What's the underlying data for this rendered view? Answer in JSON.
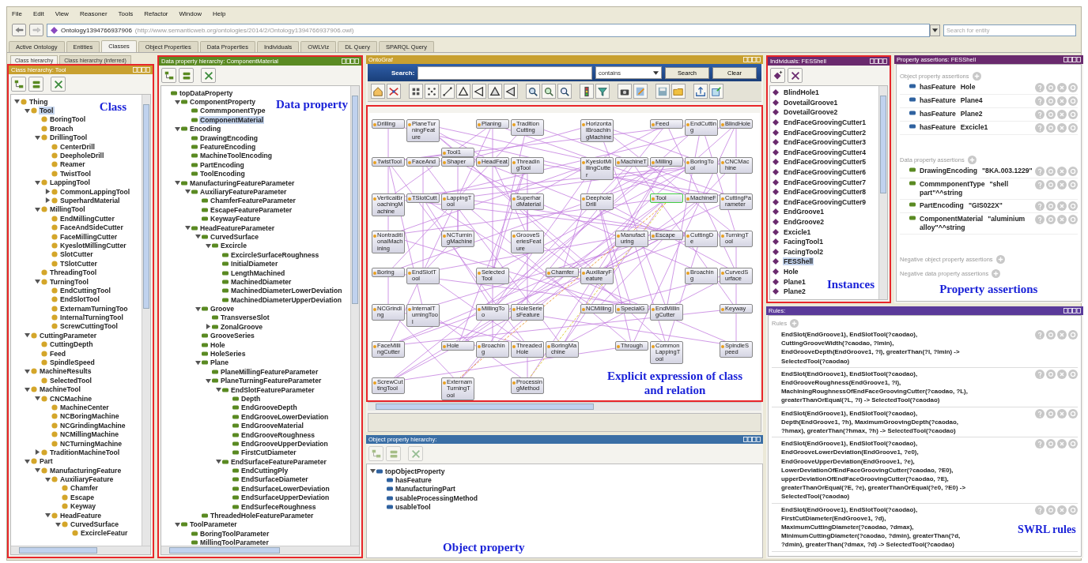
{
  "menu": [
    "File",
    "Edit",
    "View",
    "Reasoner",
    "Tools",
    "Refactor",
    "Window",
    "Help"
  ],
  "address": {
    "ontology": "Ontology1394766937906",
    "iri": "(http://www.semanticweb.org/ontologies/2014/2/Ontology1394766937906.owl)"
  },
  "entity_search": {
    "placeholder": "Search for entity"
  },
  "tabs": [
    {
      "label": "Active Ontology",
      "selected": false
    },
    {
      "label": "Entities",
      "selected": false
    },
    {
      "label": "Classes",
      "selected": true
    },
    {
      "label": "Object Properties",
      "selected": false
    },
    {
      "label": "Data Properties",
      "selected": false
    },
    {
      "label": "Individuals",
      "selected": false
    },
    {
      "label": "OWLViz",
      "selected": false
    },
    {
      "label": "DL Query",
      "selected": false
    },
    {
      "label": "SPARQL Query",
      "selected": false
    }
  ],
  "class_panel": {
    "subtabs": [
      {
        "label": "Class hierarchy",
        "selected": true
      },
      {
        "label": "Class hierarchy (inferred)",
        "selected": false
      }
    ],
    "title": "Class hierarchy: Tool",
    "annotation": "Class",
    "tree": [
      {
        "label": "Thing",
        "selected": false,
        "expanded": true,
        "children": [
          {
            "label": "Tool",
            "selected": true,
            "expanded": true,
            "children": [
              {
                "label": "BoringTool",
                "selected": false
              },
              {
                "label": "Broach",
                "selected": false
              },
              {
                "label": "DrillingTool",
                "selected": false,
                "expanded": true,
                "children": [
                  {
                    "label": "CenterDrill",
                    "selected": false
                  },
                  {
                    "label": "DeepholeDrill",
                    "selected": false
                  },
                  {
                    "label": "Reamer",
                    "selected": false
                  },
                  {
                    "label": "TwistTool",
                    "selected": false
                  }
                ]
              },
              {
                "label": "LappingTool",
                "selected": false,
                "expanded": true,
                "children": [
                  {
                    "label": "CommonLappingTool",
                    "selected": false,
                    "expanded": false
                  },
                  {
                    "label": "SuperhardMaterial",
                    "selected": false,
                    "expanded": false
                  }
                ]
              },
              {
                "label": "MillingTool",
                "selected": false,
                "expanded": true,
                "children": [
                  {
                    "label": "EndMillingCutter",
                    "selected": false
                  },
                  {
                    "label": "FaceAndSideCutter",
                    "selected": false
                  },
                  {
                    "label": "FaceMillingCutter",
                    "selected": false
                  },
                  {
                    "label": "KyeslotMillingCutter",
                    "selected": false
                  },
                  {
                    "label": "SlotCutter",
                    "selected": false
                  },
                  {
                    "label": "TSlotCutter",
                    "selected": false
                  }
                ]
              },
              {
                "label": "ThreadingTool",
                "selected": false
              },
              {
                "label": "TurningTool",
                "selected": false,
                "expanded": true,
                "children": [
                  {
                    "label": "EndCuttingTool",
                    "selected": false
                  },
                  {
                    "label": "EndSlotTool",
                    "selected": false
                  },
                  {
                    "label": "ExternamTurningToo",
                    "selected": false
                  },
                  {
                    "label": "InternalTurningTool",
                    "selected": false
                  },
                  {
                    "label": "ScrewCuttingTool",
                    "selected": false
                  }
                ]
              }
            ]
          },
          {
            "label": "CuttingParameter",
            "selected": false,
            "expanded": true,
            "children": [
              {
                "label": "CuttingDepth",
                "selected": false
              },
              {
                "label": "Feed",
                "selected": false
              },
              {
                "label": "SpindleSpeed",
                "selected": false
              }
            ]
          },
          {
            "label": "MachineResults",
            "selected": false,
            "expanded": true,
            "children": [
              {
                "label": "SelectedTool",
                "selected": false
              }
            ]
          },
          {
            "label": "MachineTool",
            "selected": false,
            "expanded": true,
            "children": [
              {
                "label": "CNCMachine",
                "selected": false,
                "expanded": true,
                "children": [
                  {
                    "label": "MachineCenter",
                    "selected": false
                  },
                  {
                    "label": "NCBoringMachine",
                    "selected": false
                  },
                  {
                    "label": "NCGrindingMachine",
                    "selected": false
                  },
                  {
                    "label": "NCMillingMachine",
                    "selected": false
                  },
                  {
                    "label": "NCTurningMachine",
                    "selected": false
                  }
                ]
              },
              {
                "label": "TraditionMachineTool",
                "selected": false,
                "expanded": false
              }
            ]
          },
          {
            "label": "Part",
            "selected": false,
            "expanded": true,
            "children": [
              {
                "label": "ManufacturingFeature",
                "selected": false,
                "expanded": true,
                "children": [
                  {
                    "label": "AuxiliaryFeature",
                    "selected": false,
                    "expanded": true,
                    "children": [
                      {
                        "label": "Chamfer",
                        "selected": false
                      },
                      {
                        "label": "Escape",
                        "selected": false
                      },
                      {
                        "label": "Keyway",
                        "selected": false
                      }
                    ]
                  },
                  {
                    "label": "HeadFeature",
                    "selected": false,
                    "expanded": true,
                    "children": [
                      {
                        "label": "CurvedSurface",
                        "selected": false,
                        "expanded": true,
                        "children": [
                          {
                            "label": "ExcircleFeatur",
                            "selected": false
                          }
                        ]
                      }
                    ]
                  }
                ]
              }
            ]
          }
        ]
      }
    ]
  },
  "data_property_panel": {
    "title": "Data property hierarchy: ComponentMaterial",
    "annotation": "Data property",
    "tree": [
      {
        "label": "topDataProperty",
        "selected": false,
        "children": [
          {
            "label": "ComponentProperty",
            "selected": false,
            "expanded": true,
            "children": [
              {
                "label": "CommmponentType",
                "selected": false
              },
              {
                "label": "ComponentMaterial",
                "selected": true
              }
            ]
          },
          {
            "label": "Encoding",
            "selected": false,
            "expanded": true,
            "children": [
              {
                "label": "DrawingEncoding",
                "selected": false
              },
              {
                "label": "FeatureEncoding",
                "selected": false
              },
              {
                "label": "MachineToolEncoding",
                "selected": false
              },
              {
                "label": "PartEncoding",
                "selected": false
              },
              {
                "label": "ToolEncoding",
                "selected": false
              }
            ]
          },
          {
            "label": "ManufacturingFeatureParameter",
            "selected": false,
            "expanded": true,
            "children": [
              {
                "label": "AuxiliaryFeatureParameter",
                "selected": false,
                "expanded": true,
                "children": [
                  {
                    "label": "ChamferFeatureParameter",
                    "selected": false
                  },
                  {
                    "label": "EscapeFeatureParameter",
                    "selected": false
                  },
                  {
                    "label": "KeywayFeature",
                    "selected": false
                  }
                ]
              },
              {
                "label": "HeadFeatureParameter",
                "selected": false,
                "expanded": true,
                "children": [
                  {
                    "label": "CurvedSurface",
                    "selected": false,
                    "expanded": true,
                    "children": [
                      {
                        "label": "Excircle",
                        "selected": false,
                        "expanded": true,
                        "children": [
                          {
                            "label": "ExcircleSurfaceRoughness",
                            "selected": false
                          },
                          {
                            "label": "InitialDiameter",
                            "selected": false
                          },
                          {
                            "label": "LengthMachined",
                            "selected": false
                          },
                          {
                            "label": "MachinedDiameter",
                            "selected": false
                          },
                          {
                            "label": "MachinedDiameterLowerDeviation",
                            "selected": false
                          },
                          {
                            "label": "MachinedDiameterUpperDeviation",
                            "selected": false
                          }
                        ]
                      }
                    ]
                  },
                  {
                    "label": "Groove",
                    "selected": false,
                    "expanded": true,
                    "children": [
                      {
                        "label": "TransverseSlot",
                        "selected": false
                      },
                      {
                        "label": "ZonalGroove",
                        "selected": false,
                        "expanded": false
                      }
                    ]
                  },
                  {
                    "label": "GrooveSeries",
                    "selected": false
                  },
                  {
                    "label": "Hole",
                    "selected": false
                  },
                  {
                    "label": "HoleSeries",
                    "selected": false
                  },
                  {
                    "label": "Plane",
                    "selected": false,
                    "expanded": true,
                    "children": [
                      {
                        "label": "PlaneMillingFeatureParameter",
                        "selected": false
                      },
                      {
                        "label": "PlaneTurningFeatureParameter",
                        "selected": false,
                        "expanded": true,
                        "children": [
                          {
                            "label": "EndSlotFeatureParameter",
                            "selected": false,
                            "expanded": true,
                            "children": [
                              {
                                "label": "Depth",
                                "selected": false
                              },
                              {
                                "label": "EndGrooveDepth",
                                "selected": false
                              },
                              {
                                "label": "EndGrooveLowerDeviation",
                                "selected": false
                              },
                              {
                                "label": "EndGrooveMaterial",
                                "selected": false
                              },
                              {
                                "label": "EndGrooveRoughness",
                                "selected": false
                              },
                              {
                                "label": "EndGrooveUpperDeviation",
                                "selected": false
                              },
                              {
                                "label": "FirstCutDiameter",
                                "selected": false
                              }
                            ]
                          },
                          {
                            "label": "EndSurfaceFeatureParameter",
                            "selected": false,
                            "expanded": true,
                            "children": [
                              {
                                "label": "EndCuttingPly",
                                "selected": false
                              },
                              {
                                "label": "EndSurfaceDiameter",
                                "selected": false
                              },
                              {
                                "label": "EndSurfaceLowerDeviation",
                                "selected": false
                              },
                              {
                                "label": "EndSurfaceUpperDeviation",
                                "selected": false
                              },
                              {
                                "label": "EndSurfeceRoughness",
                                "selected": false
                              }
                            ]
                          }
                        ]
                      }
                    ]
                  },
                  {
                    "label": "ThreadedHoleFeatureParameter",
                    "selected": false
                  }
                ]
              }
            ]
          },
          {
            "label": "ToolParameter",
            "selected": false,
            "expanded": true,
            "children": [
              {
                "label": "BoringToolParameter",
                "selected": false
              },
              {
                "label": "MillingToolParameter",
                "selected": false
              }
            ]
          }
        ]
      }
    ]
  },
  "ontograf": {
    "title": "OntoGraf",
    "search": {
      "label": "Search:",
      "mode": "contains",
      "buttons": [
        "Search",
        "Clear"
      ]
    },
    "annotation": "Explicit expression of class\nand relation",
    "nodes": [
      {
        "label": "Drilling",
        "selected": false
      },
      {
        "label": "PlaneTurningFeature",
        "selected": false
      },
      {
        "label": "Planing",
        "selected": false
      },
      {
        "label": "TraditionCutting",
        "selected": false
      },
      {
        "label": "HorizontalBroachingMachine",
        "selected": false
      },
      {
        "label": "Feed",
        "selected": false
      },
      {
        "label": "EndCutting",
        "selected": false
      },
      {
        "label": "BlindHole",
        "selected": false
      },
      {
        "label": "Tool1",
        "selected": false
      },
      {
        "label": "TwistTool",
        "selected": false
      },
      {
        "label": "FaceAnd",
        "selected": false
      },
      {
        "label": "Shaper",
        "selected": false
      },
      {
        "label": "HeadFeat",
        "selected": false
      },
      {
        "label": "ThreadingTool",
        "selected": false
      },
      {
        "label": "KyeslotMillingCutter",
        "selected": false
      },
      {
        "label": "MachineT",
        "selected": false
      },
      {
        "label": "Milling",
        "selected": false
      },
      {
        "label": "BoringTool",
        "selected": false
      },
      {
        "label": "CNCMachine",
        "selected": false
      },
      {
        "label": "VerticalBroachingMachine",
        "selected": false
      },
      {
        "label": "TSlotCutt",
        "selected": false
      },
      {
        "label": "LappingTool",
        "selected": false
      },
      {
        "label": "SuperhardMaterial",
        "selected": false
      },
      {
        "label": "DeepholeDrill",
        "selected": false
      },
      {
        "label": "Tool",
        "selected": true
      },
      {
        "label": "MachineF",
        "selected": false
      },
      {
        "label": "CuttingParameter",
        "selected": false
      },
      {
        "label": "NontraditionalMachining",
        "selected": false
      },
      {
        "label": "NCTurningMachine",
        "selected": false
      },
      {
        "label": "GrooveSeriesFeature",
        "selected": false
      },
      {
        "label": "Manufacturing",
        "selected": false
      },
      {
        "label": "Escape",
        "selected": false
      },
      {
        "label": "CuttingDe",
        "selected": false
      },
      {
        "label": "TurningTool",
        "selected": false
      },
      {
        "label": "Boring",
        "selected": false
      },
      {
        "label": "EndSlotTool",
        "selected": false
      },
      {
        "label": "SelectedTool",
        "selected": false
      },
      {
        "label": "Chamfer",
        "selected": false
      },
      {
        "label": "AuxiliaryFeature",
        "selected": false
      },
      {
        "label": "Broaching",
        "selected": false
      },
      {
        "label": "CurvedSurface",
        "selected": false
      },
      {
        "label": "NCGrinding",
        "selected": false
      },
      {
        "label": "InternalTurningTool",
        "selected": false
      },
      {
        "label": "MillingToo",
        "selected": false
      },
      {
        "label": "HoleSeriesFeature",
        "selected": false
      },
      {
        "label": "NCMilling",
        "selected": false
      },
      {
        "label": "SpecialG",
        "selected": false
      },
      {
        "label": "EndMillingCutter",
        "selected": false
      },
      {
        "label": "Keyway",
        "selected": false
      },
      {
        "label": "FaceMillingCutter",
        "selected": false
      },
      {
        "label": "Hole",
        "selected": false
      },
      {
        "label": "Broaching",
        "selected": false
      },
      {
        "label": "ThreadedHole",
        "selected": false
      },
      {
        "label": "BoringMachine",
        "selected": false
      },
      {
        "label": "Through",
        "selected": false
      },
      {
        "label": "CommonLappingTool",
        "selected": false
      },
      {
        "label": "SpindleSpeed",
        "selected": false
      },
      {
        "label": "ScrewCuttingTool",
        "selected": false
      },
      {
        "label": "ExternamTurningTool",
        "selected": false
      },
      {
        "label": "ProcessingMethod",
        "selected": false
      }
    ]
  },
  "object_property_panel": {
    "title": "Object property hierarchy:",
    "annotation": "Object property",
    "tree": [
      {
        "label": "topObjectProperty",
        "selected": false,
        "expanded": true,
        "children": [
          {
            "label": "hasFeature",
            "selected": false
          },
          {
            "label": "ManufacturingPart",
            "selected": false
          },
          {
            "label": "usableProcessingMethod",
            "selected": false
          },
          {
            "label": "usableTool",
            "selected": false
          }
        ]
      }
    ]
  },
  "individuals_panel": {
    "title": "Individuals: FESShell",
    "annotation": "Instances",
    "items": [
      {
        "label": "BlindHole1",
        "selected": false
      },
      {
        "label": "DovetailGroove1",
        "selected": false
      },
      {
        "label": "DovetailGroove2",
        "selected": false
      },
      {
        "label": "EndFaceGroovingCutter1",
        "selected": false
      },
      {
        "label": "EndFaceGroovingCutter2",
        "selected": false
      },
      {
        "label": "EndFaceGroovingCutter3",
        "selected": false
      },
      {
        "label": "EndFaceGroovingCutter4",
        "selected": false
      },
      {
        "label": "EndFaceGroovingCutter5",
        "selected": false
      },
      {
        "label": "EndFaceGroovingCutter6",
        "selected": false
      },
      {
        "label": "EndFaceGroovingCutter7",
        "selected": false
      },
      {
        "label": "EndFaceGroovingCutter8",
        "selected": false
      },
      {
        "label": "EndFaceGroovingCutter9",
        "selected": false
      },
      {
        "label": "EndGroove1",
        "selected": false
      },
      {
        "label": "EndGroove2",
        "selected": false
      },
      {
        "label": "Excicle1",
        "selected": false
      },
      {
        "label": "FacingTool1",
        "selected": false
      },
      {
        "label": "FacingTool2",
        "selected": false
      },
      {
        "label": "FESShell",
        "selected": true
      },
      {
        "label": "Hole",
        "selected": false
      },
      {
        "label": "Plane1",
        "selected": false
      },
      {
        "label": "Plane2",
        "selected": false
      }
    ]
  },
  "property_assertions_panel": {
    "title": "Property assertions: FESShell",
    "annotation": "Property assertions",
    "sections": [
      {
        "heading": "Object property assertions",
        "kind": "object",
        "rows": [
          {
            "property": "hasFeature",
            "value": "Hole"
          },
          {
            "property": "hasFeature",
            "value": "Plane4"
          },
          {
            "property": "hasFeature",
            "value": "Plane2"
          },
          {
            "property": "hasFeature",
            "value": "Excicle1"
          }
        ]
      },
      {
        "heading": "Data property assertions",
        "kind": "data",
        "rows": [
          {
            "property": "DrawingEncoding",
            "value": "\"8KA.003.1229\""
          },
          {
            "property": "CommmponentType",
            "value": "\"shell part\"^^string"
          },
          {
            "property": "PartEncoding",
            "value": "\"GIS022X\""
          },
          {
            "property": "ComponentMaterial",
            "value": "\"aluminium alloy\"^^string"
          }
        ]
      },
      {
        "heading": "Negative object property assertions"
      },
      {
        "heading": "Negative data property assertions"
      }
    ]
  },
  "rules_panel": {
    "title": "Rules:",
    "heading": "Rules",
    "annotation": "SWRL rules",
    "rules": [
      "EndSlot(EndGroove1), EndSlotTool(?caodao),\nCuttingGrooveWidth(?caodao, ?lmin),\nEndGrooveDepth(EndGroove1, ?l), greaterThan(?l, ?lmin) ->\nSelectedTool(?caodao)",
      "EndSlot(EndGroove1), EndSlotTool(?caodao),\nEndGrooveRoughness(EndGroove1, ?l),\nMachiningRoughnessOfEndFaceGroovingCutter(?caodao, ?L),\ngreaterThanOrEqual(?L, ?l) -> SelectedTool(?caodao)",
      "EndSlot(EndGroove1), EndSlotTool(?caodao),\nDepth(EndGroove1, ?h), MaximumGroovingDepth(?caodao,\n?hmax), greaterThan(?hmax, ?h) -> SelectedTool(?caodao)",
      "EndSlot(EndGroove1), EndSlotTool(?caodao),\nEndGrooveLowerDeviation(EndGroove1, ?e0),\nEndGrooveUpperDeviation(EndGroove1, ?e),\nLowerDeviationOfEndFaceGroovingCutter(?caodao, ?E0),\nupperDeviationOfEndFaceGroovingCutter(?caodao, ?E),\ngreaterThanOrEqual(?E, ?e), greaterThanOrEqual(?e0, ?E0) ->\nSelectedTool(?caodao)",
      "EndSlot(EndGroove1), EndSlotTool(?caodao),\nFirstCutDiameter(EndGroove1, ?d),\nMaximumCuttingDiameter(?caodao, ?dmax),\nMinimumCuttingDiameter(?caodao, ?dmin), greaterThan(?d,\n?dmin), greaterThan(?dmax, ?d) -> SelectedTool(?caodao)"
    ]
  }
}
